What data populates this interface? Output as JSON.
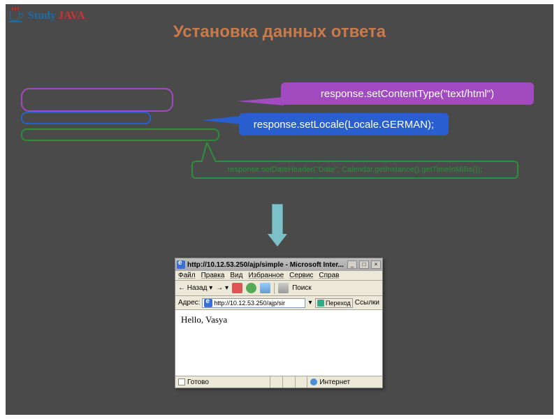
{
  "logo": {
    "study": "Study",
    "java": "JAVA"
  },
  "title": "Установка данных ответа",
  "callouts": {
    "purple": "response.setContentType(\"text/html\")",
    "blue": "response.setLocale(Locale.GERMAN);",
    "green": "response.setDateHeader(\"Date\", Calendar.getInstance().getTimeInMillis());"
  },
  "browser": {
    "title": "http://10.12.53.250/ajp/simple - Microsoft Inter...",
    "menu": [
      "Файл",
      "Правка",
      "Вид",
      "Избранное",
      "Сервис",
      "Справ"
    ],
    "back": "Назад",
    "search": "Поиск",
    "address_label": "Адрес:",
    "address_value": "http://10.12.53.250/ajp/sir",
    "go": "Переход",
    "links": "Ссылки",
    "content": "Hello, Vasya",
    "status_done": "Готово",
    "status_zone": "Интернет"
  }
}
